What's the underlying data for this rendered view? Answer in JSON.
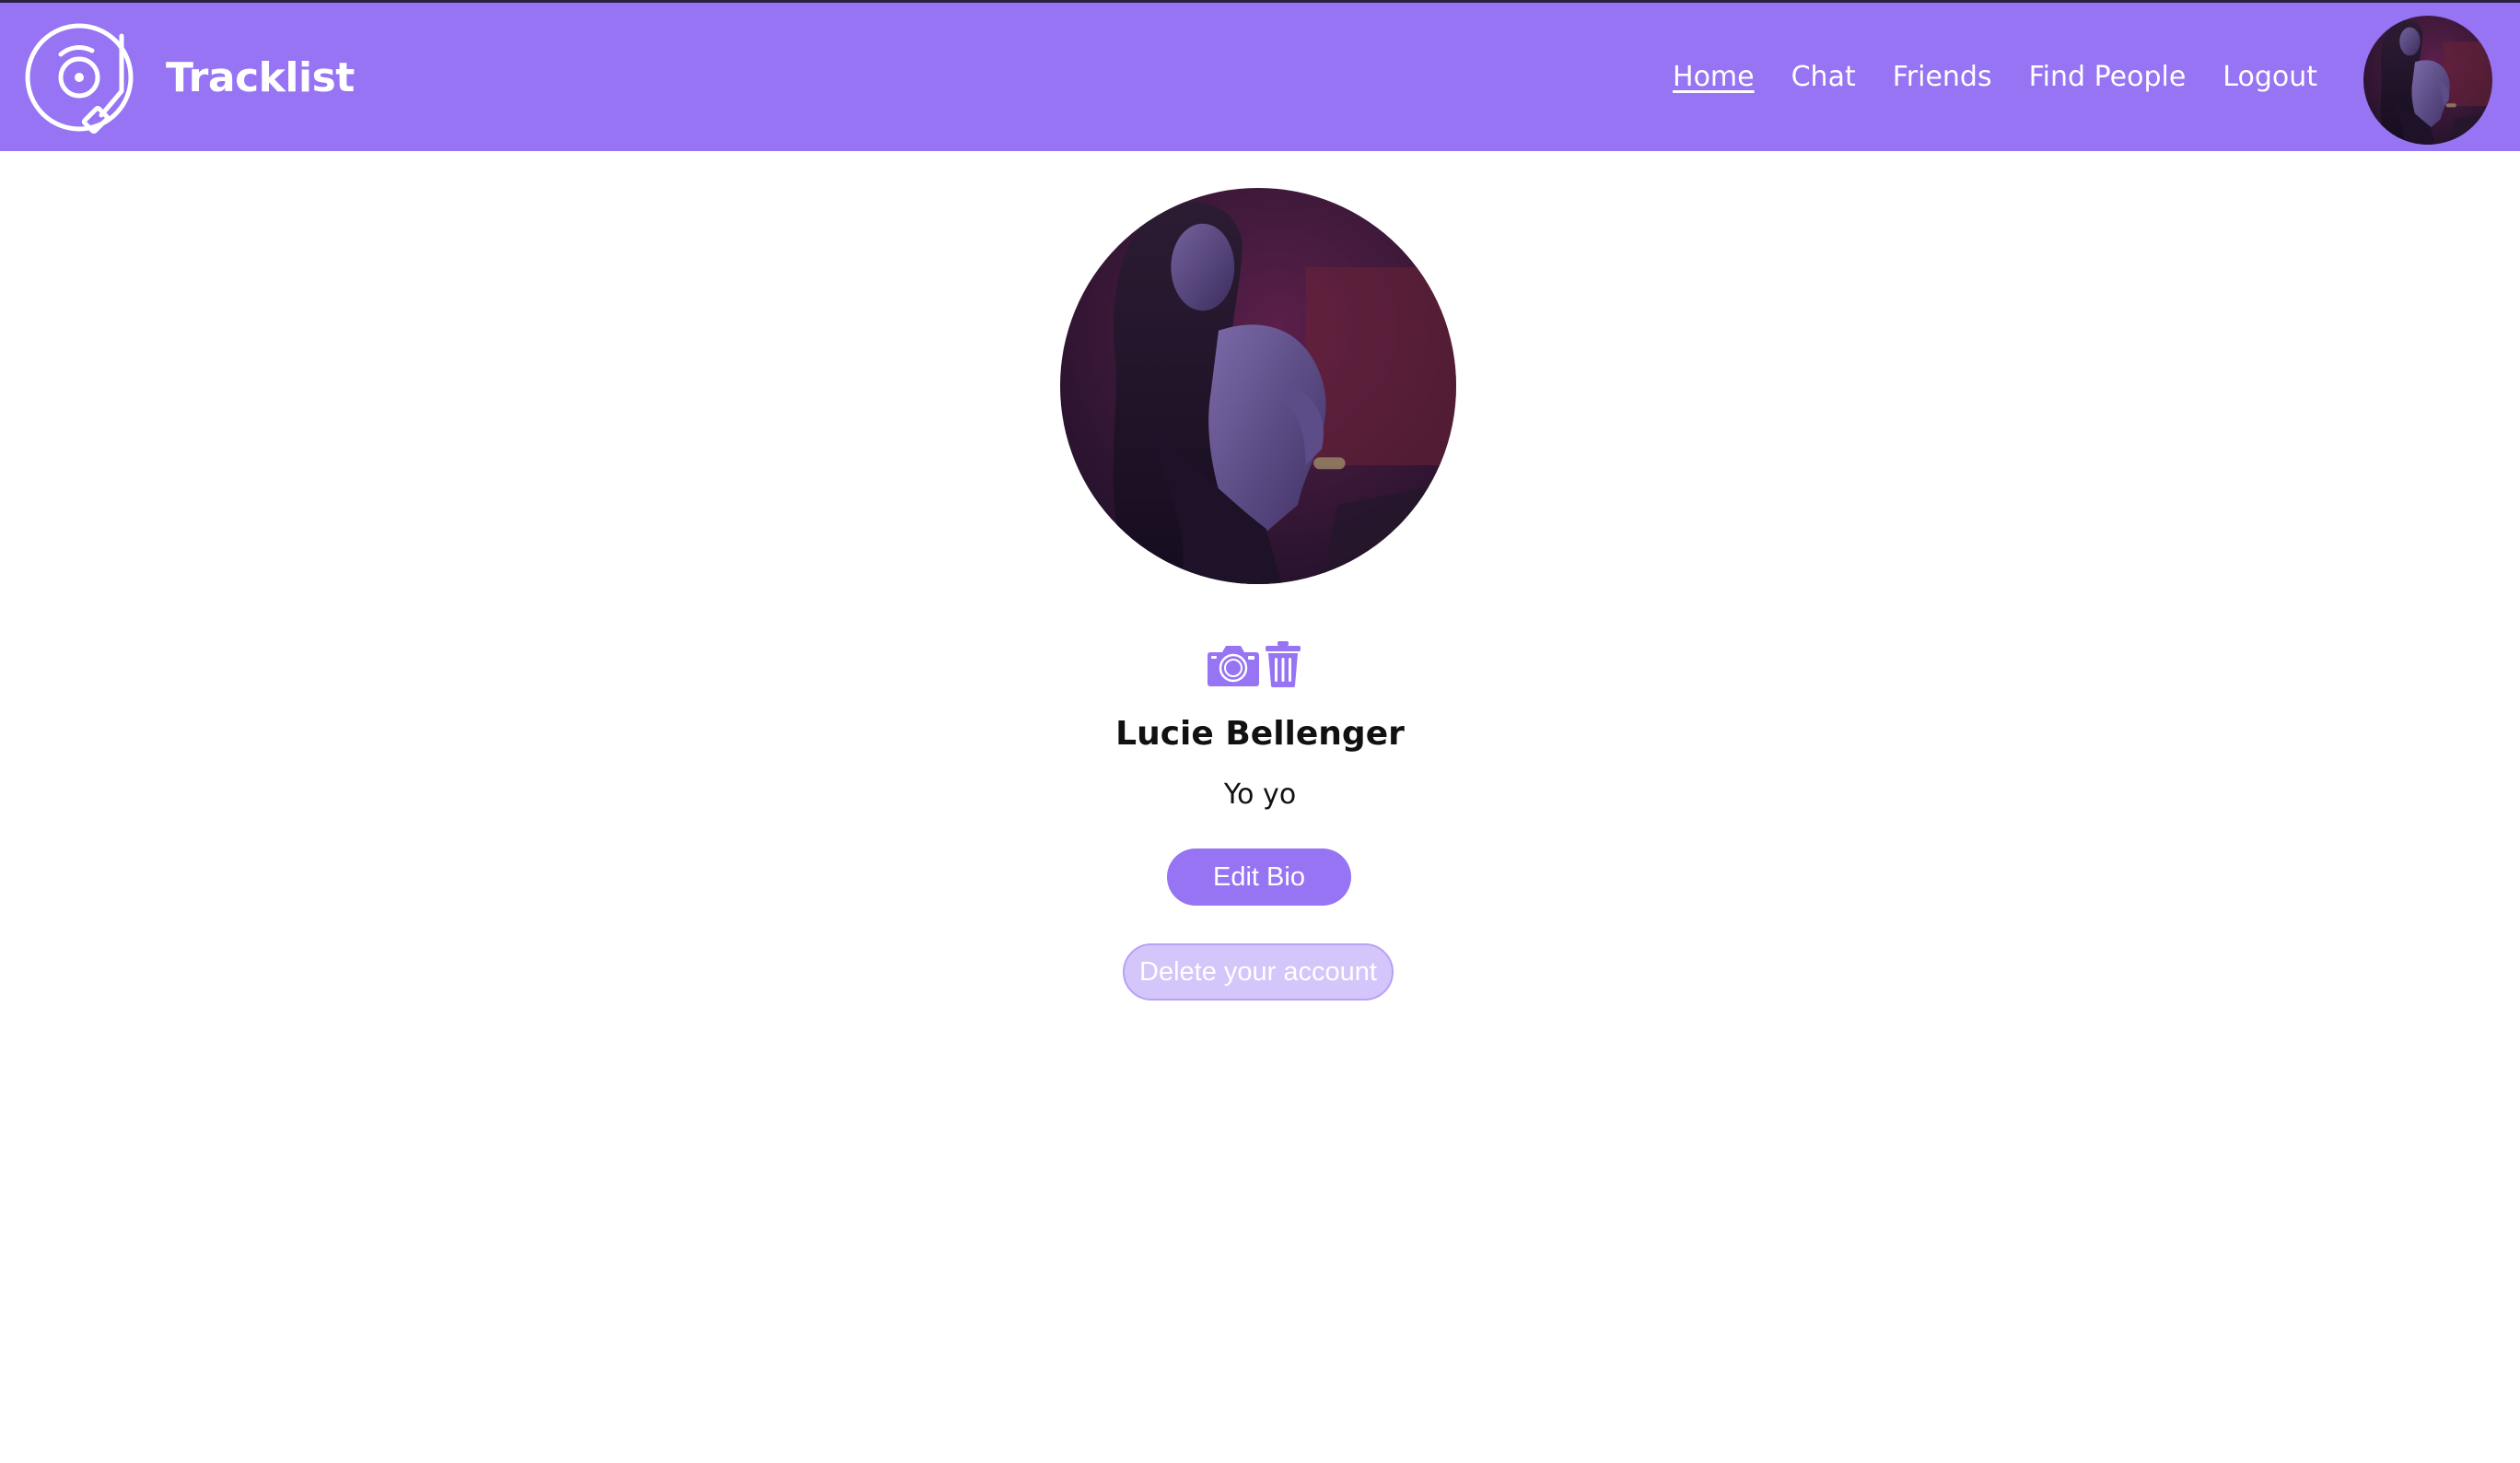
{
  "app": {
    "name": "Tracklist",
    "logo_icon": "turntable-record-icon",
    "brand_color": "#9674f3"
  },
  "nav": {
    "links": [
      {
        "label": "Home",
        "active": true
      },
      {
        "label": "Chat",
        "active": false
      },
      {
        "label": "Friends",
        "active": false
      },
      {
        "label": "Find People",
        "active": false
      },
      {
        "label": "Logout",
        "active": false
      }
    ],
    "avatar_icon": "user-avatar"
  },
  "profile": {
    "name": "Lucie Bellenger",
    "bio": "Yo yo",
    "upload_icon": "camera-icon",
    "delete_icon": "trash-icon",
    "edit_bio_label": "Edit Bio",
    "delete_account_label": "Delete your account"
  },
  "colors": {
    "navbar": "#9674f3",
    "primary_button": "#9674f3",
    "danger_button_disabled": "#d4c5fa",
    "text": "#111111"
  }
}
